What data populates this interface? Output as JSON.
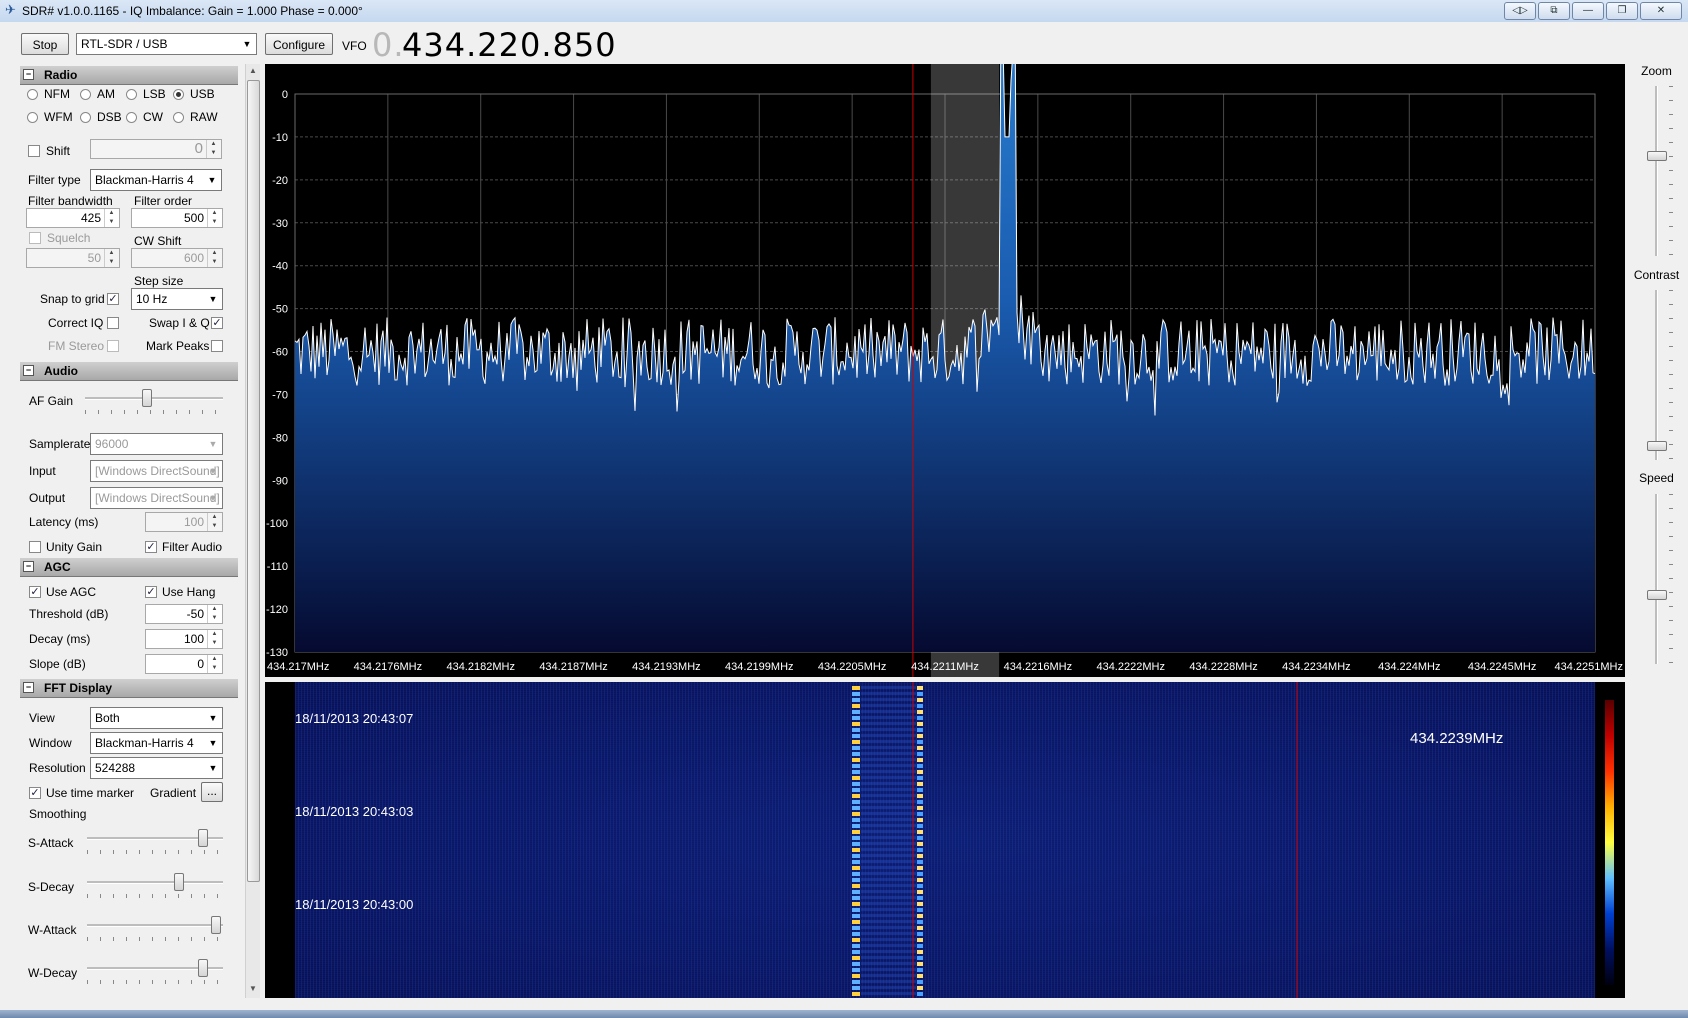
{
  "window": {
    "title": "SDR# v1.0.0.1165 - IQ Imbalance: Gain = 1.000 Phase = 0.000°",
    "buttons": [
      "◁▷",
      "⧉",
      "—",
      "❐",
      "✕"
    ]
  },
  "toolbar": {
    "stop_label": "Stop",
    "device": "RTL-SDR / USB",
    "configure_label": "Configure",
    "vfo_label": "VFO",
    "vfo_dim": "0.",
    "vfo_value": "434.220.850"
  },
  "radio": {
    "header": "Radio",
    "modes": [
      {
        "label": "NFM",
        "selected": false
      },
      {
        "label": "AM",
        "selected": false
      },
      {
        "label": "LSB",
        "selected": false
      },
      {
        "label": "USB",
        "selected": true
      },
      {
        "label": "WFM",
        "selected": false
      },
      {
        "label": "DSB",
        "selected": false
      },
      {
        "label": "CW",
        "selected": false
      },
      {
        "label": "RAW",
        "selected": false
      }
    ],
    "shift_label": "Shift",
    "shift_value": "0",
    "filter_type_label": "Filter type",
    "filter_type": "Blackman-Harris 4",
    "filter_bandwidth_label": "Filter bandwidth",
    "filter_bandwidth": "425",
    "filter_order_label": "Filter order",
    "filter_order": "500",
    "squelch_label": "Squelch",
    "squelch_value": "50",
    "cw_shift_label": "CW Shift",
    "cw_shift_value": "600",
    "step_size_label": "Step size",
    "step_size": "10 Hz",
    "snap_to_grid_label": "Snap to grid",
    "correct_iq_label": "Correct IQ",
    "swap_iq_label": "Swap I & Q",
    "fm_stereo_label": "FM Stereo",
    "mark_peaks_label": "Mark Peaks"
  },
  "audio": {
    "header": "Audio",
    "af_gain_label": "AF Gain",
    "samplerate_label": "Samplerate",
    "samplerate": "96000",
    "input_label": "Input",
    "input": "[Windows DirectSound]",
    "output_label": "Output",
    "output": "[Windows DirectSound]",
    "latency_label": "Latency (ms)",
    "latency": "100",
    "unity_gain_label": "Unity Gain",
    "filter_audio_label": "Filter Audio"
  },
  "agc": {
    "header": "AGC",
    "use_agc_label": "Use AGC",
    "use_hang_label": "Use Hang",
    "threshold_label": "Threshold (dB)",
    "threshold": "-50",
    "decay_label": "Decay (ms)",
    "decay": "100",
    "slope_label": "Slope (dB)",
    "slope": "0"
  },
  "fft": {
    "header": "FFT Display",
    "view_label": "View",
    "view": "Both",
    "window_label": "Window",
    "window": "Blackman-Harris 4",
    "resolution_label": "Resolution",
    "resolution": "524288",
    "use_time_marker_label": "Use time marker",
    "gradient_label": "Gradient",
    "gradient_button": "...",
    "smoothing_label": "Smoothing",
    "s_attack_label": "S-Attack",
    "s_decay_label": "S-Decay",
    "w_attack_label": "W-Attack",
    "w_decay_label": "W-Decay"
  },
  "right_panel": {
    "zoom_label": "Zoom",
    "contrast_label": "Contrast",
    "speed_label": "Speed"
  },
  "waterfall": {
    "timestamps": [
      "18/11/2013 20:43:07",
      "18/11/2013 20:43:03",
      "18/11/2013 20:43:00"
    ],
    "cursor_freq": "434.2239MHz"
  },
  "chart_data": {
    "type": "line",
    "title": "",
    "xlabel": "",
    "ylabel": "",
    "x_tick_labels": [
      "434.217MHz",
      "434.2176MHz",
      "434.2182MHz",
      "434.2187MHz",
      "434.2193MHz",
      "434.2199MHz",
      "434.2205MHz",
      "434.2211MHz",
      "434.2216MHz",
      "434.2222MHz",
      "434.2228MHz",
      "434.2234MHz",
      "434.224MHz",
      "434.2245MHz",
      "434.2251MHz"
    ],
    "y_tick_labels": [
      "0",
      "-10",
      "-20",
      "-30",
      "-40",
      "-50",
      "-60",
      "-70",
      "-80",
      "-90",
      "-100",
      "-110",
      "-120",
      "-130"
    ],
    "ylim": [
      -130,
      0
    ],
    "grid": true,
    "noise_floor_db": -60,
    "peak": {
      "frequency_mhz": 434.22133,
      "level_db": -10
    },
    "filter_passband_mhz": [
      434.22085,
      434.221275
    ],
    "vfo_marker_mhz": 434.22085,
    "colors": {
      "background": "#000000",
      "trace": "#ffffff",
      "fill_top": "#2a7fd0",
      "fill_bottom": "#050a30",
      "marker": "#cc0000"
    }
  }
}
